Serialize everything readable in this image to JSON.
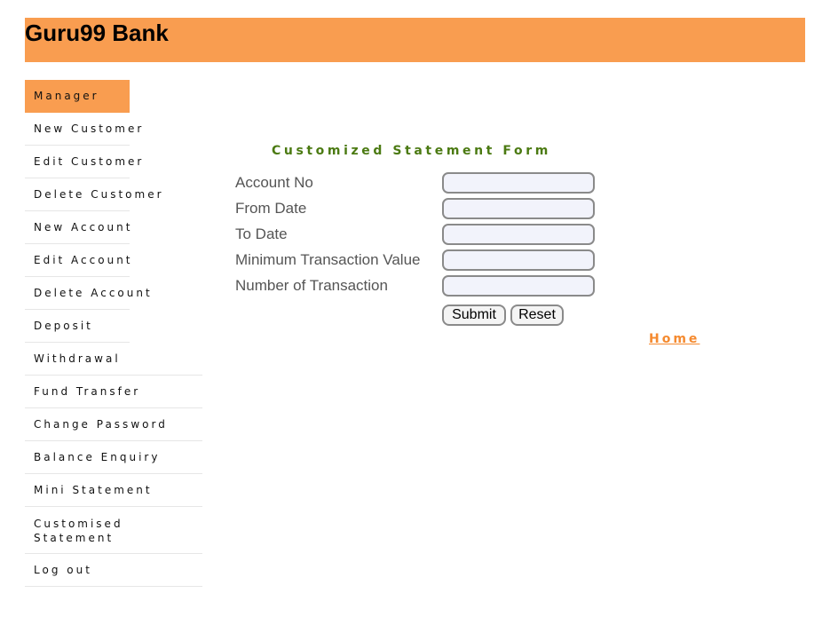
{
  "header": {
    "title": "Guru99 Bank",
    "background_color": "#f99d50"
  },
  "sidebar": {
    "items": [
      {
        "label": "Manager",
        "active": true
      },
      {
        "label": "New Customer"
      },
      {
        "label": "Edit Customer"
      },
      {
        "label": "Delete Customer"
      },
      {
        "label": "New Account"
      },
      {
        "label": "Edit Account"
      },
      {
        "label": "Delete Account"
      },
      {
        "label": "Deposit"
      },
      {
        "label": "Withdrawal"
      },
      {
        "label": "Fund Transfer"
      },
      {
        "label": "Change Password"
      },
      {
        "label": "Balance Enquiry"
      },
      {
        "label": "Mini Statement"
      },
      {
        "label": "Customised Statement"
      },
      {
        "label": "Log out"
      }
    ]
  },
  "form": {
    "title": "Customized Statement Form",
    "title_color": "#4b7a12",
    "fields": [
      {
        "label": "Account No",
        "value": ""
      },
      {
        "label": "From Date",
        "value": ""
      },
      {
        "label": "To Date",
        "value": ""
      },
      {
        "label": "Minimum Transaction Value",
        "value": ""
      },
      {
        "label": "Number of Transaction",
        "value": ""
      }
    ],
    "submit_label": "Submit",
    "reset_label": "Reset"
  },
  "home_link": {
    "label": "Home",
    "color": "#f58a2f"
  }
}
